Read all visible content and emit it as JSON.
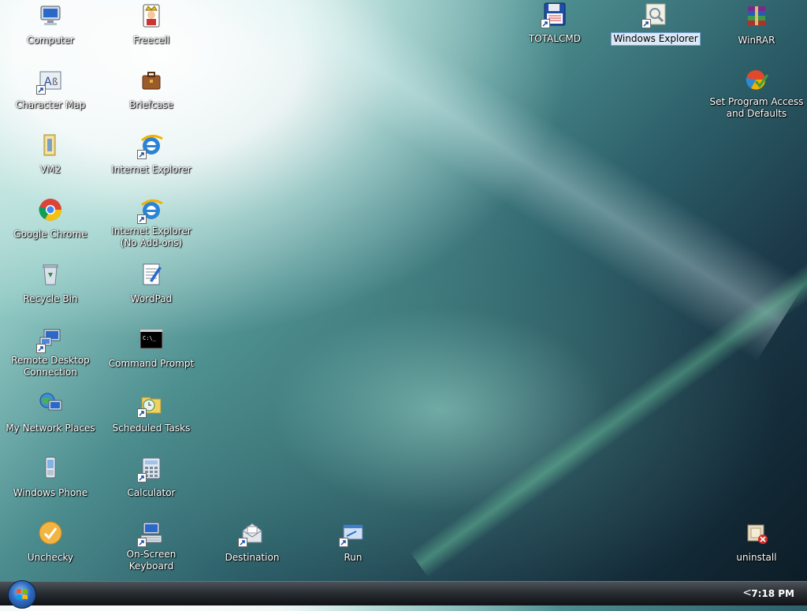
{
  "desktop": {
    "icons": [
      {
        "id": "computer",
        "label": "Computer"
      },
      {
        "id": "freecell",
        "label": "Freecell"
      },
      {
        "id": "totalcmd",
        "label": "TOTALCMD"
      },
      {
        "id": "windows-explorer",
        "label": "Windows Explorer"
      },
      {
        "id": "winrar",
        "label": "WinRAR"
      },
      {
        "id": "character-map",
        "label": "Character Map"
      },
      {
        "id": "briefcase",
        "label": "Briefcase"
      },
      {
        "id": "set-program-access",
        "label": "Set Program Access and Defaults"
      },
      {
        "id": "vm2",
        "label": "VM2"
      },
      {
        "id": "internet-explorer",
        "label": "Internet Explorer"
      },
      {
        "id": "google-chrome",
        "label": "Google Chrome"
      },
      {
        "id": "ie-no-addons",
        "label": "Internet Explorer (No Add-ons)"
      },
      {
        "id": "recycle-bin",
        "label": "Recycle Bin"
      },
      {
        "id": "wordpad",
        "label": "WordPad"
      },
      {
        "id": "remote-desktop",
        "label": "Remote Desktop Connection"
      },
      {
        "id": "command-prompt",
        "label": "Command Prompt"
      },
      {
        "id": "my-network-places",
        "label": "My Network Places"
      },
      {
        "id": "scheduled-tasks",
        "label": "Scheduled Tasks"
      },
      {
        "id": "windows-phone",
        "label": "Windows Phone"
      },
      {
        "id": "calculator",
        "label": "Calculator"
      },
      {
        "id": "unchecky",
        "label": "Unchecky"
      },
      {
        "id": "on-screen-keyboard",
        "label": "On-Screen Keyboard"
      },
      {
        "id": "destination",
        "label": "Destination"
      },
      {
        "id": "run",
        "label": "Run"
      },
      {
        "id": "uninstall",
        "label": "uninstall"
      }
    ],
    "selected_icon": "Windows Explorer"
  },
  "taskbar": {
    "clock": "7:18 PM",
    "tray_expand_glyph": "<"
  },
  "colors": {
    "label_text": "#ffffff",
    "selection_bg": "#dbe9f7",
    "taskbar_dark": "#0f1114"
  }
}
